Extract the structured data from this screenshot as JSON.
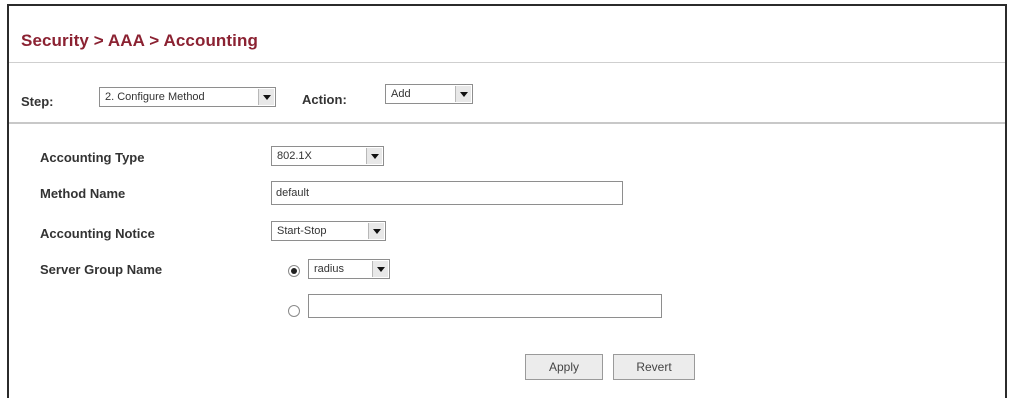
{
  "header": {
    "title": "Security > AAA > Accounting"
  },
  "step_bar": {
    "step_label": "Step:",
    "step_value": "2. Configure Method",
    "action_label": "Action:",
    "action_value": "Add"
  },
  "form": {
    "accounting_type_label": "Accounting Type",
    "accounting_type_value": "802.1X",
    "method_name_label": "Method Name",
    "method_name_value": "default",
    "accounting_notice_label": "Accounting Notice",
    "accounting_notice_value": "Start-Stop",
    "server_group_label": "Server Group Name",
    "server_group_select_value": "radius",
    "server_group_text_value": ""
  },
  "buttons": {
    "apply": "Apply",
    "revert": "Revert"
  }
}
